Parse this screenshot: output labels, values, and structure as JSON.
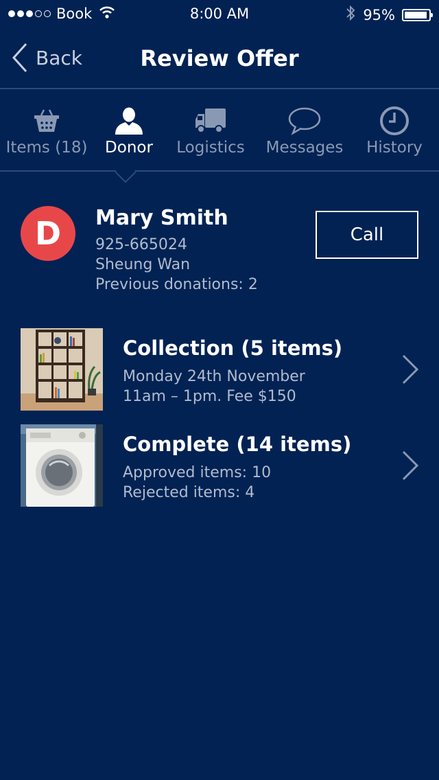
{
  "status_bar": {
    "carrier": "Book",
    "time": "8:00 AM",
    "battery": "95%",
    "battery_level": 0.95,
    "signal_bars_filled": 3,
    "signal_bars_total": 5
  },
  "nav": {
    "back_label": "Back",
    "title": "Review Offer"
  },
  "tabs": [
    {
      "label": "Items (18)",
      "icon": "basket-icon",
      "active": false
    },
    {
      "label": "Donor",
      "icon": "person-icon",
      "active": true
    },
    {
      "label": "Logistics",
      "icon": "truck-icon",
      "active": false
    },
    {
      "label": "Messages",
      "icon": "speech-bubble-icon",
      "active": false
    },
    {
      "label": "History",
      "icon": "clock-icon",
      "active": false
    }
  ],
  "donor": {
    "initial": "D",
    "name": "Mary Smith",
    "phone": "925-665024",
    "location": "Sheung Wan",
    "previous_donations": "Previous donations: 2",
    "call_label": "Call"
  },
  "rows": [
    {
      "title": "Collection (5 items)",
      "line1": "Monday 24th November",
      "line2": "11am – 1pm. Fee $150",
      "image": "bookshelf-photo"
    },
    {
      "title": "Complete (14 items)",
      "line1": "Approved items: 10",
      "line2": "Rejected items: 4",
      "image": "washing-machine-photo"
    }
  ],
  "colors": {
    "background": "#012253",
    "avatar": "#e8474a",
    "muted_text": "#b0bccd",
    "inactive_tab": "#8a99b3"
  }
}
